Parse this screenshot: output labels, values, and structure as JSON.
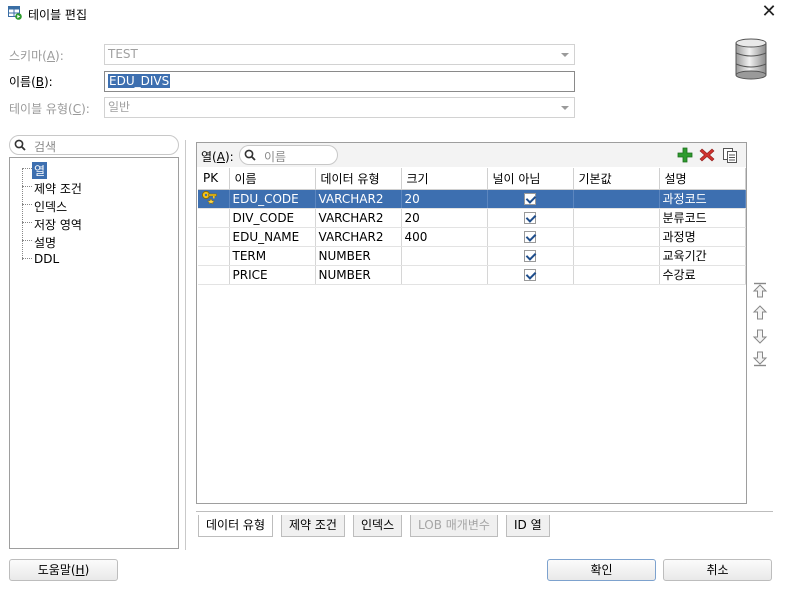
{
  "window": {
    "title": "테이블 편집",
    "close_glyph": "✕"
  },
  "form": {
    "schema_label": "스키마(",
    "schema_mnemonic": "A",
    "schema_label_tail": "):",
    "schema_value": "TEST",
    "name_label": "이름(",
    "name_mnemonic": "B",
    "name_label_tail": "):",
    "name_value": "EDU_DIVS",
    "type_label": "테이블 유형(",
    "type_mnemonic": "C",
    "type_label_tail": "):",
    "type_value": "일반"
  },
  "left": {
    "search_placeholder": "검색",
    "tree": [
      "열",
      "제약 조건",
      "인덱스",
      "저장 영역",
      "설명",
      "DDL"
    ]
  },
  "columns_panel": {
    "label": "열(",
    "mnemonic": "A",
    "label_tail": "):",
    "filter_placeholder": "이름",
    "headers": [
      "PK",
      "이름",
      "데이터 유형",
      "크기",
      "널이 아님",
      "기본값",
      "설명"
    ],
    "rows": [
      {
        "pk": true,
        "name": "EDU_CODE",
        "type": "VARCHAR2",
        "size": "20",
        "not_null": true,
        "default": "",
        "comment": "과정코드"
      },
      {
        "pk": false,
        "name": "DIV_CODE",
        "type": "VARCHAR2",
        "size": "20",
        "not_null": true,
        "default": "",
        "comment": "분류코드"
      },
      {
        "pk": false,
        "name": "EDU_NAME",
        "type": "VARCHAR2",
        "size": "400",
        "not_null": true,
        "default": "",
        "comment": "과정명"
      },
      {
        "pk": false,
        "name": "TERM",
        "type": "NUMBER",
        "size": "",
        "not_null": true,
        "default": "",
        "comment": "교육기간"
      },
      {
        "pk": false,
        "name": "PRICE",
        "type": "NUMBER",
        "size": "",
        "not_null": true,
        "default": "",
        "comment": "수강료"
      }
    ],
    "selected_row": 0
  },
  "bottom_tabs": [
    "데이터 유형",
    "제약 조건",
    "인덱스",
    "LOB 매개변수",
    "ID 열"
  ],
  "buttons": {
    "help_label": "도움말(",
    "help_mnemonic": "H",
    "help_tail": ")",
    "ok": "확인",
    "cancel": "취소"
  },
  "colors": {
    "selection": "#3d6fb0",
    "add_icon": "#2e9b2e",
    "delete_icon": "#d0312d"
  }
}
